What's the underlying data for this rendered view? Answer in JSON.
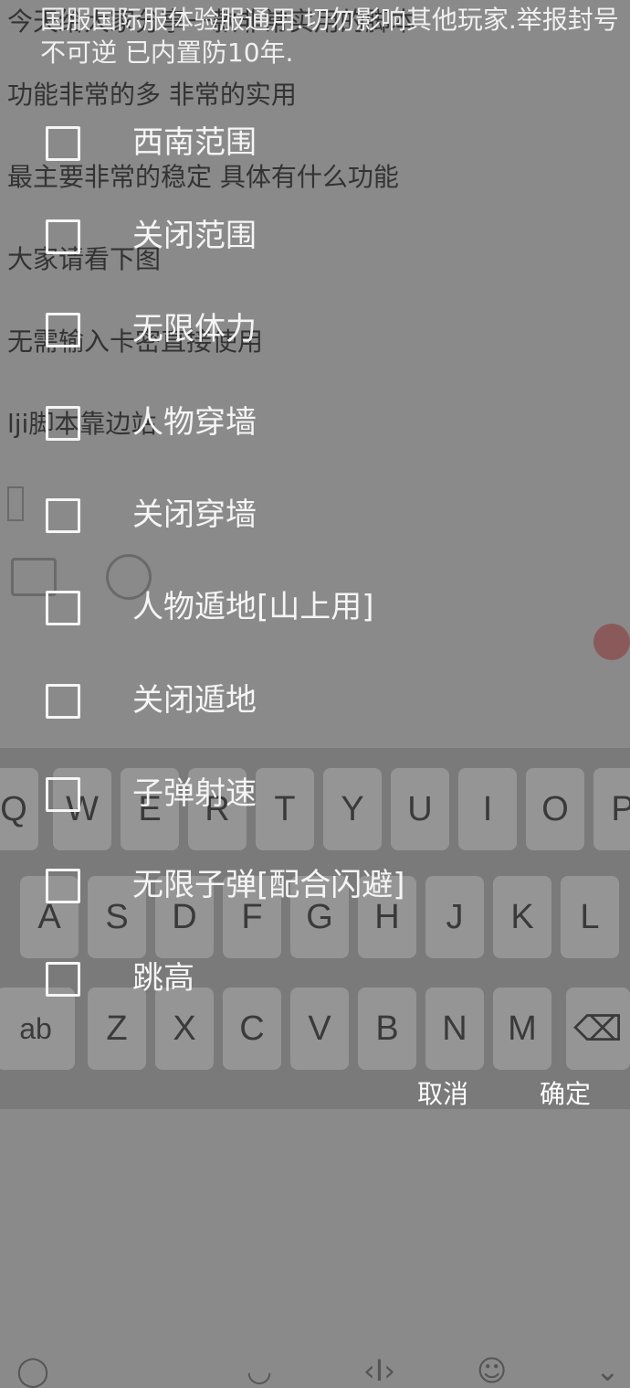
{
  "background_post": {
    "lines": [
      "今天给大家分享一款非常实用的脚本",
      "功能非常的多 非常的实用",
      "最主要非常的稳定 具体有什么功能",
      "大家请看下图",
      "无需输入卡密直接使用",
      "lji脚本靠边站"
    ]
  },
  "keyboard": {
    "toolbar_icons": [
      "voice-input-icon",
      "emoji-icon",
      "cursor-icon",
      "smiley-icon",
      "chevron-down-icon"
    ],
    "row1": [
      "Q",
      "W",
      "E",
      "R",
      "T",
      "Y",
      "U",
      "I",
      "O",
      "P"
    ],
    "row2": [
      "A",
      "S",
      "D",
      "F",
      "G",
      "H",
      "J",
      "K",
      "L"
    ],
    "row3": [
      "ab",
      "Z",
      "X",
      "C",
      "V",
      "B",
      "N",
      "M",
      "⌫"
    ]
  },
  "dialog": {
    "header": "国服国际服体验服通用.切勿影响其他玩家.举报封号不可逆 已内置防10年.",
    "options": [
      {
        "label": "西南范围",
        "checked": false
      },
      {
        "label": "关闭范围",
        "checked": false
      },
      {
        "label": "无限体力",
        "checked": false
      },
      {
        "label": "人物穿墙",
        "checked": false
      },
      {
        "label": "关闭穿墙",
        "checked": false
      },
      {
        "label": "人物遁地[山上用]",
        "checked": false
      },
      {
        "label": "关闭遁地",
        "checked": false
      },
      {
        "label": "子弹射速",
        "checked": false
      },
      {
        "label": "无限子弹[配合闪避]",
        "checked": false
      },
      {
        "label": "跳高",
        "checked": false
      }
    ],
    "cancel_label": "取消",
    "confirm_label": "确定"
  }
}
